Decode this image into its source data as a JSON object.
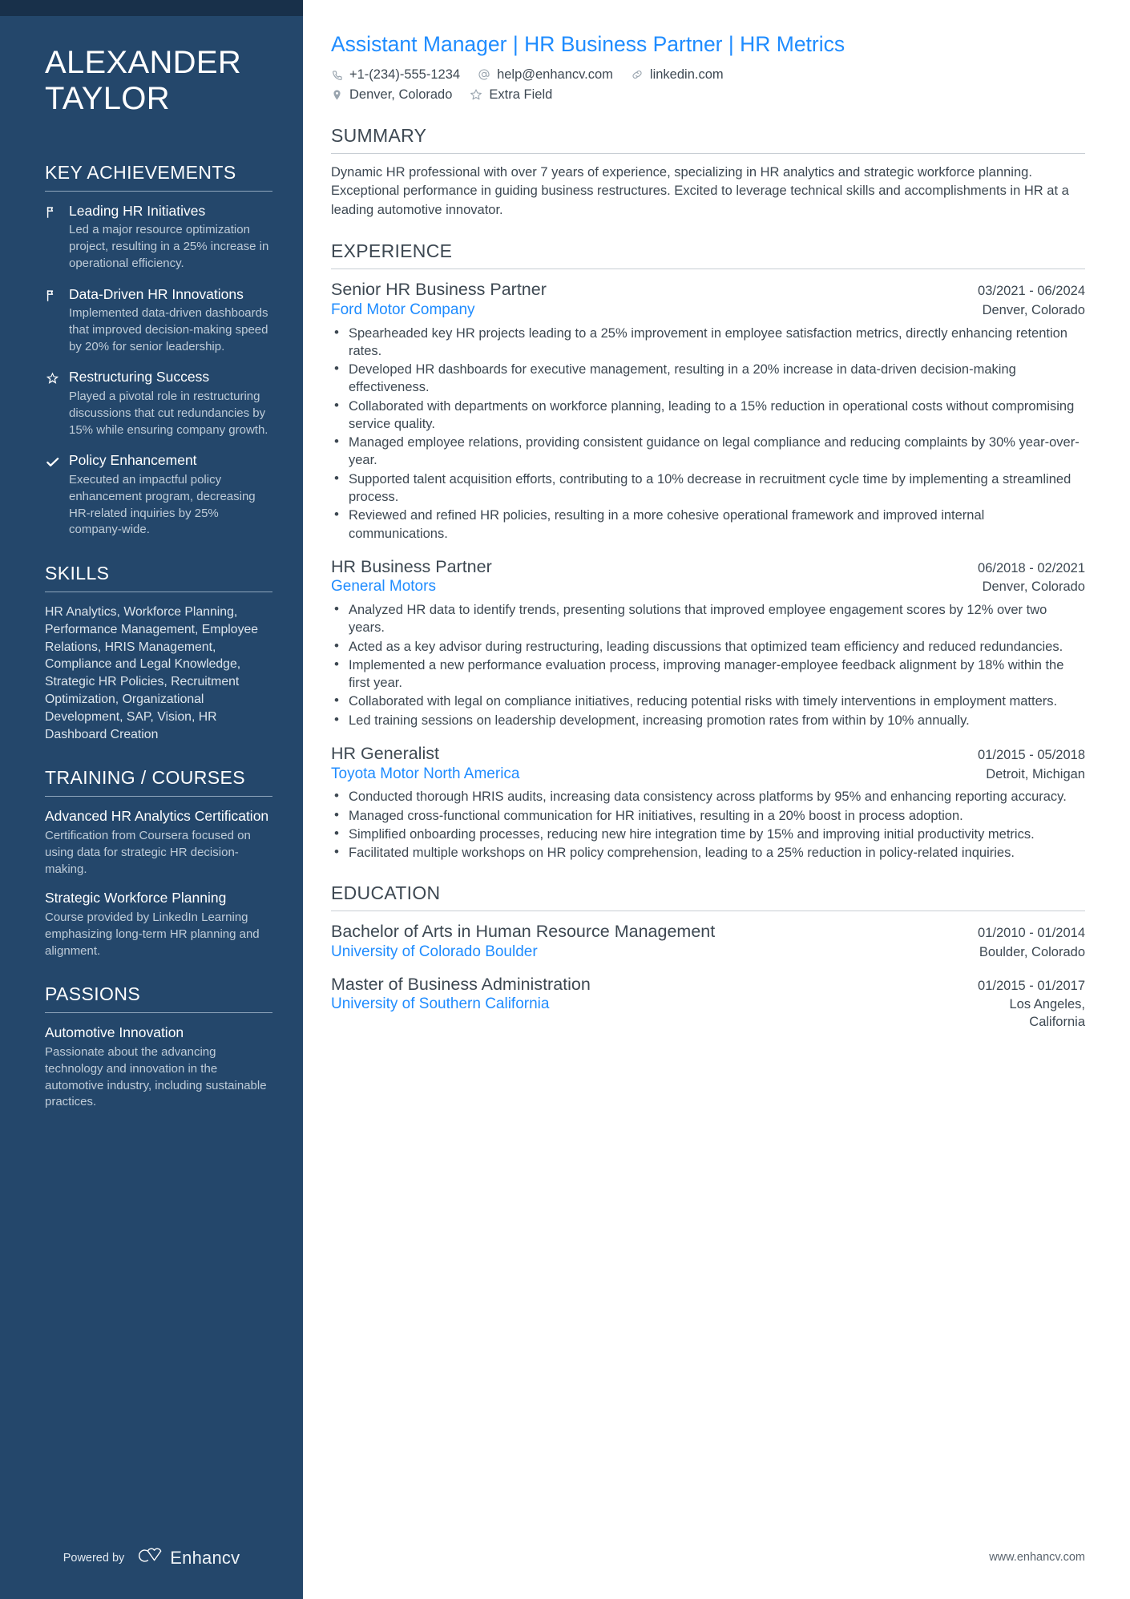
{
  "colors": {
    "sidebar_bg": "#24476B",
    "sidebar_topbar": "#18304A",
    "accent_blue": "#1F8CFF",
    "body_text": "#3D4852",
    "muted_text": "#BFCCD8"
  },
  "sidebar": {
    "name_line1": "ALEXANDER",
    "name_line2": "TAYLOR",
    "achievements": {
      "heading": "KEY ACHIEVEMENTS",
      "items": [
        {
          "icon": "flag-icon",
          "title": "Leading HR Initiatives",
          "desc": "Led a major resource optimization project, resulting in a 25% increase in operational efficiency."
        },
        {
          "icon": "flag-icon",
          "title": "Data-Driven HR Innovations",
          "desc": "Implemented data-driven dashboards that improved decision-making speed by 20% for senior leadership."
        },
        {
          "icon": "star-icon",
          "title": "Restructuring Success",
          "desc": "Played a pivotal role in restructuring discussions that cut redundancies by 15% while ensuring company growth."
        },
        {
          "icon": "check-icon",
          "title": "Policy Enhancement",
          "desc": "Executed an impactful policy enhancement program, decreasing HR-related inquiries by 25% company-wide."
        }
      ]
    },
    "skills": {
      "heading": "SKILLS",
      "text": "HR Analytics, Workforce Planning, Performance Management, Employee Relations, HRIS Management, Compliance and Legal Knowledge, Strategic HR Policies, Recruitment Optimization, Organizational Development, SAP, Vision, HR Dashboard Creation"
    },
    "training": {
      "heading": "TRAINING / COURSES",
      "items": [
        {
          "title": "Advanced HR Analytics Certification",
          "desc": "Certification from Coursera focused on using data for strategic HR decision-making."
        },
        {
          "title": "Strategic Workforce Planning",
          "desc": "Course provided by LinkedIn Learning emphasizing long-term HR planning and alignment."
        }
      ]
    },
    "passions": {
      "heading": "PASSIONS",
      "items": [
        {
          "title": "Automotive Innovation",
          "desc": "Passionate about the advancing technology and innovation in the automotive industry, including sustainable practices."
        }
      ]
    },
    "footer": {
      "powered_by": "Powered by",
      "brand": "Enhancv",
      "logo_icon": "enhancv-logo-icon"
    }
  },
  "main": {
    "headline": "Assistant Manager | HR Business Partner | HR Metrics",
    "contacts_row1": [
      {
        "icon": "phone-icon",
        "text": "+1-(234)-555-1234"
      },
      {
        "icon": "at-sign-icon",
        "text": "help@enhancv.com"
      },
      {
        "icon": "link-icon",
        "text": "linkedin.com"
      }
    ],
    "contacts_row2": [
      {
        "icon": "map-pin-icon",
        "text": "Denver, Colorado"
      },
      {
        "icon": "star-outline-icon",
        "text": "Extra Field"
      }
    ],
    "summary": {
      "heading": "SUMMARY",
      "text": "Dynamic HR professional with over 7 years of experience, specializing in HR analytics and strategic workforce planning. Exceptional performance in guiding business restructures. Excited to leverage technical skills and accomplishments in HR at a leading automotive innovator."
    },
    "experience": {
      "heading": "EXPERIENCE",
      "jobs": [
        {
          "title": "Senior HR Business Partner",
          "dates": "03/2021 - 06/2024",
          "company": "Ford Motor Company",
          "location": "Denver, Colorado",
          "bullets": [
            "Spearheaded key HR projects leading to a 25% improvement in employee satisfaction metrics, directly enhancing retention rates.",
            "Developed HR dashboards for executive management, resulting in a 20% increase in data-driven decision-making effectiveness.",
            "Collaborated with departments on workforce planning, leading to a 15% reduction in operational costs without compromising service quality.",
            "Managed employee relations, providing consistent guidance on legal compliance and reducing complaints by 30% year-over-year.",
            "Supported talent acquisition efforts, contributing to a 10% decrease in recruitment cycle time by implementing a streamlined process.",
            "Reviewed and refined HR policies, resulting in a more cohesive operational framework and improved internal communications."
          ]
        },
        {
          "title": "HR Business Partner",
          "dates": "06/2018 - 02/2021",
          "company": "General Motors",
          "location": "Denver, Colorado",
          "bullets": [
            "Analyzed HR data to identify trends, presenting solutions that improved employee engagement scores by 12% over two years.",
            "Acted as a key advisor during restructuring, leading discussions that optimized team efficiency and reduced redundancies.",
            "Implemented a new performance evaluation process, improving manager-employee feedback alignment by 18% within the first year.",
            "Collaborated with legal on compliance initiatives, reducing potential risks with timely interventions in employment matters.",
            "Led training sessions on leadership development, increasing promotion rates from within by 10% annually."
          ]
        },
        {
          "title": "HR Generalist",
          "dates": "01/2015 - 05/2018",
          "company": "Toyota Motor North America",
          "location": "Detroit, Michigan",
          "bullets": [
            "Conducted thorough HRIS audits, increasing data consistency across platforms by 95% and enhancing reporting accuracy.",
            "Managed cross-functional communication for HR initiatives, resulting in a 20% boost in process adoption.",
            "Simplified onboarding processes, reducing new hire integration time by 15% and improving initial productivity metrics.",
            "Facilitated multiple workshops on HR policy comprehension, leading to a 25% reduction in policy-related inquiries."
          ]
        }
      ]
    },
    "education": {
      "heading": "EDUCATION",
      "degrees": [
        {
          "title": "Bachelor of Arts in Human Resource Management",
          "dates": "01/2010 - 01/2014",
          "school": "University of Colorado Boulder",
          "location": "Boulder, Colorado"
        },
        {
          "title": "Master of Business Administration",
          "dates": "01/2015 - 01/2017",
          "school": "University of Southern California",
          "location": "Los Angeles,\nCalifornia"
        }
      ]
    },
    "footer_url": "www.enhancv.com"
  }
}
